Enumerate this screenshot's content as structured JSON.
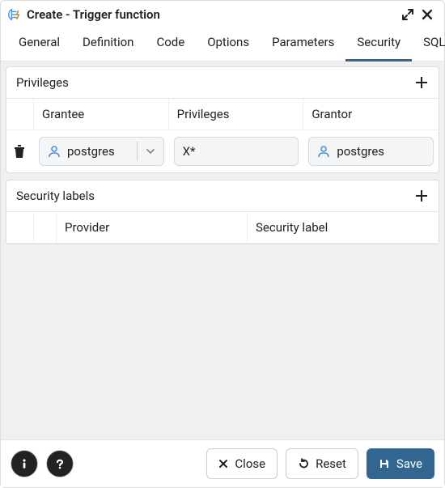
{
  "dialog": {
    "title": "Create - Trigger function"
  },
  "tabs": [
    {
      "label": "General"
    },
    {
      "label": "Definition"
    },
    {
      "label": "Code"
    },
    {
      "label": "Options"
    },
    {
      "label": "Parameters"
    },
    {
      "label": "Security",
      "active": true
    },
    {
      "label": "SQL"
    }
  ],
  "privileges": {
    "header": "Privileges",
    "columns": {
      "grantee": "Grantee",
      "privileges": "Privileges",
      "grantor": "Grantor"
    },
    "rows": [
      {
        "grantee": "postgres",
        "privileges": "X*",
        "grantor": "postgres"
      }
    ]
  },
  "security_labels": {
    "header": "Security labels",
    "columns": {
      "provider": "Provider",
      "label": "Security label"
    }
  },
  "footer": {
    "close": "Close",
    "reset": "Reset",
    "save": "Save"
  }
}
